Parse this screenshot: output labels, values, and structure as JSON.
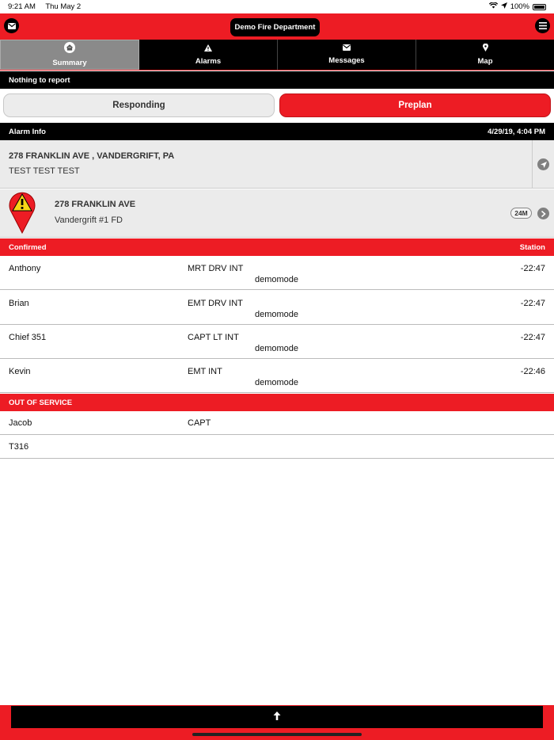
{
  "status": {
    "time": "9:21 AM",
    "date": "Thu May 2",
    "battery": "100%"
  },
  "header": {
    "title": "Demo Fire Department"
  },
  "tabs": [
    {
      "label": "Summary",
      "icon": "home-icon",
      "active": true
    },
    {
      "label": "Alarms",
      "icon": "warning-icon",
      "active": false
    },
    {
      "label": "Messages",
      "icon": "envelope-icon",
      "active": false
    },
    {
      "label": "Map",
      "icon": "map-pin-icon",
      "active": false
    }
  ],
  "notice": "Nothing to report",
  "actions": {
    "responding": "Responding",
    "preplan": "Preplan"
  },
  "alarm": {
    "header": "Alarm Info",
    "timestamp": "4/29/19, 4:04 PM",
    "address_full": "278 FRANKLIN AVE , VANDERGRIFT, PA",
    "description": "TEST TEST TEST",
    "incident_address": "278 FRANKLIN AVE",
    "department": "Vandergrift #1 FD",
    "age_badge": "24M"
  },
  "confirmed": {
    "header": "Confirmed",
    "station_label": "Station",
    "rows": [
      {
        "name": "Anthony",
        "position": "MRT DRV INT",
        "mode": "demomode",
        "time": "-22:47"
      },
      {
        "name": "Brian",
        "position": "EMT DRV INT",
        "mode": "demomode",
        "time": "-22:47"
      },
      {
        "name": "Chief 351",
        "position": "CAPT LT INT",
        "mode": "demomode",
        "time": "-22:47"
      },
      {
        "name": "Kevin",
        "position": "EMT INT",
        "mode": "demomode",
        "time": "-22:46"
      }
    ]
  },
  "out_of_service": {
    "header": "OUT OF SERVICE",
    "rows": [
      {
        "name": "Jacob",
        "position": "CAPT"
      },
      {
        "name": "T316",
        "position": ""
      }
    ]
  },
  "colors": {
    "brand_red": "#ed1c24",
    "active_tab": "#8a8a8a"
  }
}
